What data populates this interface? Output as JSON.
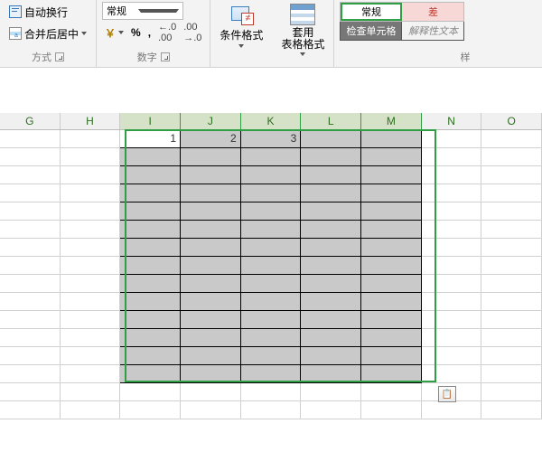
{
  "ribbon": {
    "alignment": {
      "wrap_text": "自动换行",
      "merge_center": "合并后居中",
      "group_label": "方式"
    },
    "number": {
      "format_selected": "常规",
      "currency": "￥",
      "percent": "%",
      "comma": ",",
      "inc_decimal": ".0  .00",
      "dec_decimal": ".00  .0",
      "group_label": "数字"
    },
    "cond_format": "条件格式",
    "table_format": "套用\n表格格式",
    "styles": {
      "general": "常规",
      "bad": "差",
      "check_cell": "检查单元格",
      "explanatory": "解释性文本",
      "group_label": "样"
    }
  },
  "sheet": {
    "columns": [
      "G",
      "H",
      "I",
      "J",
      "K",
      "L",
      "M",
      "N",
      "O"
    ],
    "selected_cols": [
      "I",
      "J",
      "K",
      "L",
      "M"
    ],
    "rows_visible": 16,
    "selection": {
      "first_row": 1,
      "last_row": 14,
      "first_col": 2,
      "last_col": 6
    },
    "data": {
      "r1": {
        "I": "1",
        "J": "2",
        "K": "3"
      }
    }
  }
}
